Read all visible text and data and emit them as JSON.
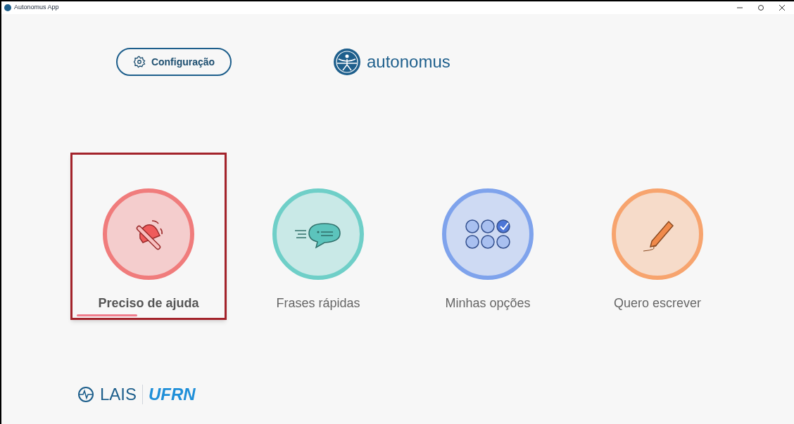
{
  "window": {
    "title": "Autonomus App"
  },
  "settings_button": {
    "label": "Configuração"
  },
  "brand": {
    "name": "autonomus"
  },
  "cards": [
    {
      "kind": "bell",
      "label": "Preciso de ajuda",
      "color": "#f07c7c",
      "selected": true
    },
    {
      "kind": "chat",
      "label": "Frases rápidas",
      "color": "#6fcfc8",
      "selected": false
    },
    {
      "kind": "options",
      "label": "Minhas opções",
      "color": "#7fa3ec",
      "selected": false
    },
    {
      "kind": "pencil",
      "label": "Quero escrever",
      "color": "#f7a46e",
      "selected": false
    }
  ],
  "footer": {
    "lais": "LAIS",
    "ufrn": "UFRN"
  }
}
